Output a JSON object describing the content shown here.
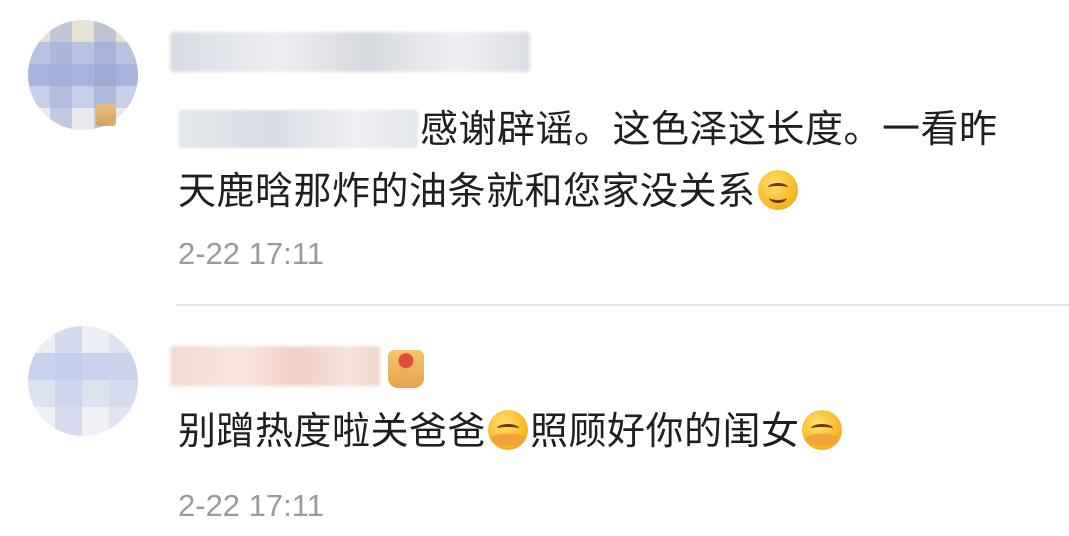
{
  "comments": [
    {
      "text_after_mention": "感谢辟谣。这色泽这长度。一看昨天鹿晗那炸的油条就和您家没关系",
      "emoji": "smile-emoji",
      "timestamp": "2-22 17:11"
    },
    {
      "text_part1": "别蹭热度啦关爸爸",
      "text_part2": "照顾好你的闺女",
      "emoji": "hug-emoji",
      "timestamp": "2-22 17:11"
    }
  ],
  "colors": {
    "text": "#1f1f1f",
    "timestamp": "#9a9a9a",
    "divider": "#e5e5e5"
  }
}
